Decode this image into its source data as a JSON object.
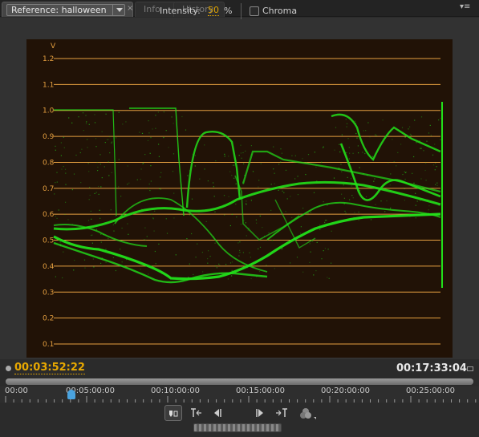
{
  "tabs": {
    "reference": "Reference: halloween",
    "info": "Info",
    "history": "History"
  },
  "icons": {
    "close": "×",
    "panel_menu": "▾≡"
  },
  "toolbar": {
    "intensity_label": "Intensity:",
    "intensity_value": "50",
    "intensity_unit": "%",
    "chroma_label": "Chroma",
    "chroma_checked": false
  },
  "scope": {
    "axis_label": "V",
    "levels": [
      "1.2",
      "1.1",
      "1.0",
      "0.9",
      "0.8",
      "0.7",
      "0.6",
      "0.5",
      "0.4",
      "0.3",
      "0.2",
      "0.1"
    ],
    "line_color": "#e6a040",
    "trace_color": "#22e01a"
  },
  "timeline": {
    "current_time": "00:03:52:22",
    "duration": "00:17:33:04",
    "ruler": [
      "00:00",
      "00:05:00:00",
      "00:10:00:00",
      "00:15:00:00",
      "00:20:00:00",
      "00:25:00:00"
    ]
  },
  "colors": {
    "accent": "#e8a800",
    "playhead": "#4aa3df"
  }
}
